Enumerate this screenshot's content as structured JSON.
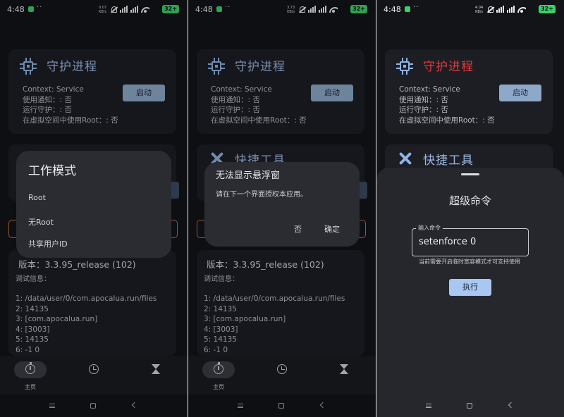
{
  "status": {
    "time": "4:48",
    "dots": "··",
    "speeds": [
      "0.07\nKB/s",
      "3.73\nKB/s",
      "4.04\nKB/s"
    ],
    "battery": "32+"
  },
  "guard": {
    "title": "守护进程",
    "context": "Context: Service",
    "notify": "使用通知：: 否",
    "running": "运行守护：: 否",
    "root_in_vspace": "在虚拟空间中使用Root：: 否",
    "start_label": "启动"
  },
  "tools": {
    "title": "快捷工具"
  },
  "info": {
    "version": "版本：3.3.95_release (102)",
    "debug_label": "调试信息：",
    "lines": [
      "1: /data/user/0/com.apocalua.run/files",
      "2: 14135",
      "3: [com.apocalua.run]",
      "4: [3003]",
      "5: 14135",
      "6: -1 0"
    ]
  },
  "nav": {
    "home_label": "主页"
  },
  "dialog_mode": {
    "title": "工作模式",
    "options": [
      "Root",
      "无Root",
      "共享用户ID"
    ]
  },
  "dialog_float": {
    "title": "无法显示悬浮窗",
    "message": "请在下一个界面授权本应用。",
    "no": "否",
    "ok": "确定"
  },
  "super_cmd": {
    "title": "超级命令",
    "input_label": "输入命令",
    "input_value": "setenforce 0",
    "hint": "当前需要开启临时宽容模式才可支持使用",
    "exec_label": "执行"
  },
  "colors": {
    "accent": "#9ab7e0",
    "title_red": "#e23a3a",
    "button": "#8ea8c8",
    "exec_button": "#a9c7f3",
    "background": "#131418",
    "card": "#1d1e24"
  }
}
